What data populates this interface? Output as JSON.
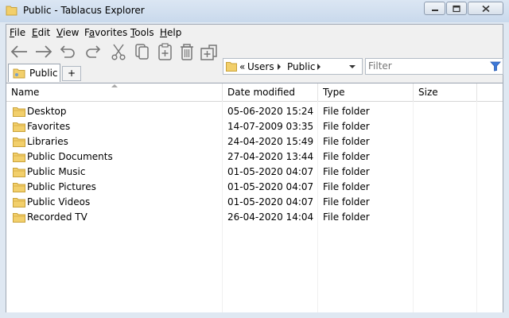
{
  "window": {
    "title": "Public - Tablacus Explorer"
  },
  "menu": [
    {
      "key": "F",
      "rest": "ile"
    },
    {
      "key": "E",
      "rest": "dit"
    },
    {
      "key": "V",
      "rest": "iew"
    },
    {
      "key": "",
      "pre": "F",
      "key2": "a",
      "rest": "vorites"
    },
    {
      "key": "T",
      "rest": "ools"
    },
    {
      "key": "H",
      "rest": "elp"
    }
  ],
  "toolbar": {
    "icons": [
      "back-arrow-icon",
      "forward-arrow-icon",
      "undo-icon",
      "redo-icon",
      "cut-icon",
      "copy-icon",
      "paste-icon",
      "delete-icon",
      "new-folder-icon"
    ]
  },
  "address": {
    "prefix": "«",
    "parts": [
      "Users",
      "Public"
    ]
  },
  "filter": {
    "placeholder": "Filter"
  },
  "tabs": [
    {
      "label": "Public"
    }
  ],
  "tab_add": "+",
  "columns": {
    "name": "Name",
    "date": "Date modified",
    "type": "Type",
    "size": "Size"
  },
  "files": [
    {
      "name": "Desktop",
      "date": "05-06-2020 15:24",
      "type": "File folder",
      "size": ""
    },
    {
      "name": "Favorites",
      "date": "14-07-2009 03:35",
      "type": "File folder",
      "size": ""
    },
    {
      "name": "Libraries",
      "date": "24-04-2020 15:49",
      "type": "File folder",
      "size": ""
    },
    {
      "name": "Public Documents",
      "date": "27-04-2020 13:44",
      "type": "File folder",
      "size": ""
    },
    {
      "name": "Public Music",
      "date": "01-05-2020 04:07",
      "type": "File folder",
      "size": ""
    },
    {
      "name": "Public Pictures",
      "date": "01-05-2020 04:07",
      "type": "File folder",
      "size": ""
    },
    {
      "name": "Public Videos",
      "date": "01-05-2020 04:07",
      "type": "File folder",
      "size": ""
    },
    {
      "name": "Recorded TV",
      "date": "26-04-2020 14:04",
      "type": "File folder",
      "size": ""
    }
  ],
  "colors": {
    "folder": "#e8c35a",
    "accent": "#3c78d8"
  }
}
